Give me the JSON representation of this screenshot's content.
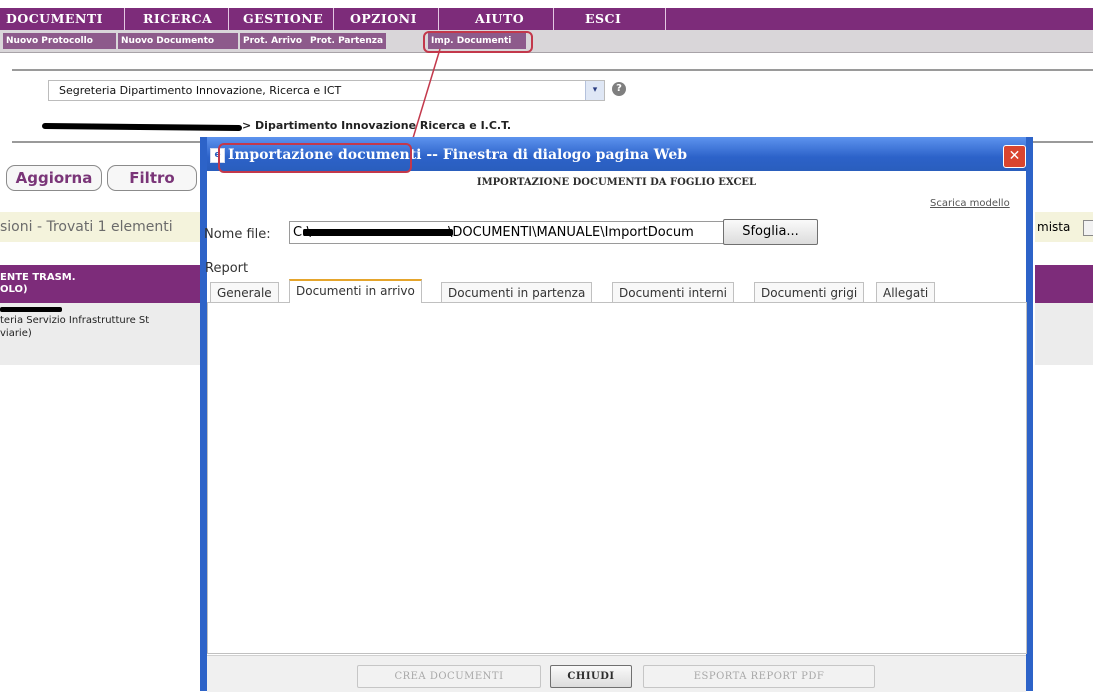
{
  "menu": {
    "items": [
      "DOCUMENTI",
      "RICERCA",
      "GESTIONE",
      "OPZIONI",
      "AIUTO",
      "ESCI"
    ]
  },
  "submenu": {
    "items": [
      "Nuovo Protocollo",
      "Nuovo Documento",
      "Prot. Arrivo",
      "Prot. Partenza",
      "Imp. Documenti"
    ]
  },
  "ufficio_select": {
    "value": "Segreteria Dipartimento Innovazione, Ricerca e ICT",
    "arrow": "▾"
  },
  "help_icon": "?",
  "breadcrumb": {
    "text": "> Dipartimento Innovazione Ricerca e I.C.T."
  },
  "buttons": {
    "aggiorna": "Aggiorna",
    "filtro": "Filtro"
  },
  "background": {
    "found_text": "sioni - Trovati 1 elementi",
    "column_header_line1": "ENTE TRASM.",
    "column_header_line2": "OLO)",
    "row_line1": "teria Servizio Infrastrutture St",
    "row_line2": "viarie)",
    "right_text": "mista"
  },
  "dialog": {
    "title_highlight": "Importazione documenti",
    "title_rest": " -- Finestra di dialogo pagina Web",
    "close": "✕",
    "heading": "IMPORTAZIONE DOCUMENTI DA FOGLIO EXCEL",
    "download_link": "Scarica modello",
    "file_label": "Nome file:",
    "file_prefix": "C:\\",
    "file_suffix": "\\DOCUMENTI\\MANUALE\\ImportDocum",
    "browse": "Sfoglia...",
    "report_label": "Report",
    "tabs": [
      "Generale",
      "Documenti in arrivo",
      "Documenti in partenza",
      "Documenti interni",
      "Documenti grigi",
      "Allegati"
    ],
    "active_tab": "Documenti in arrivo",
    "footer": {
      "crea": "CREA DOCUMENTI",
      "chiudi": "CHIUDI",
      "esporta": "ESPORTA REPORT PDF"
    }
  },
  "colors": {
    "menu_purple": "#7d2c7a",
    "dialog_blue": "#2d63c8",
    "highlight_red": "#c3384b"
  }
}
